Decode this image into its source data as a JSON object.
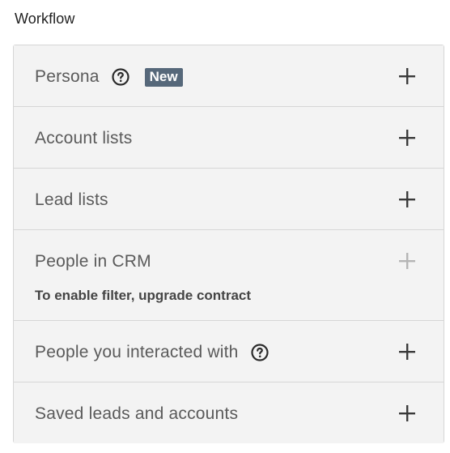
{
  "section": {
    "title": "Workflow"
  },
  "filters": [
    {
      "label": "Persona",
      "has_help": true,
      "badge": "New",
      "enabled": true
    },
    {
      "label": "Account lists",
      "has_help": false,
      "enabled": true
    },
    {
      "label": "Lead lists",
      "has_help": false,
      "enabled": true
    },
    {
      "label": "People in CRM",
      "has_help": false,
      "enabled": false,
      "note": "To enable filter, upgrade contract"
    },
    {
      "label": "People you interacted with",
      "has_help": true,
      "enabled": true
    },
    {
      "label": "Saved leads and accounts",
      "has_help": false,
      "enabled": true
    }
  ],
  "icons": {
    "help": "help-circle-icon",
    "add": "plus-icon"
  },
  "colors": {
    "badge_bg": "#56687a",
    "panel_bg": "#f3f3f3",
    "border": "#d6d6d6",
    "plus_enabled": "#3a3a3a",
    "plus_disabled": "#b5b5b5"
  }
}
